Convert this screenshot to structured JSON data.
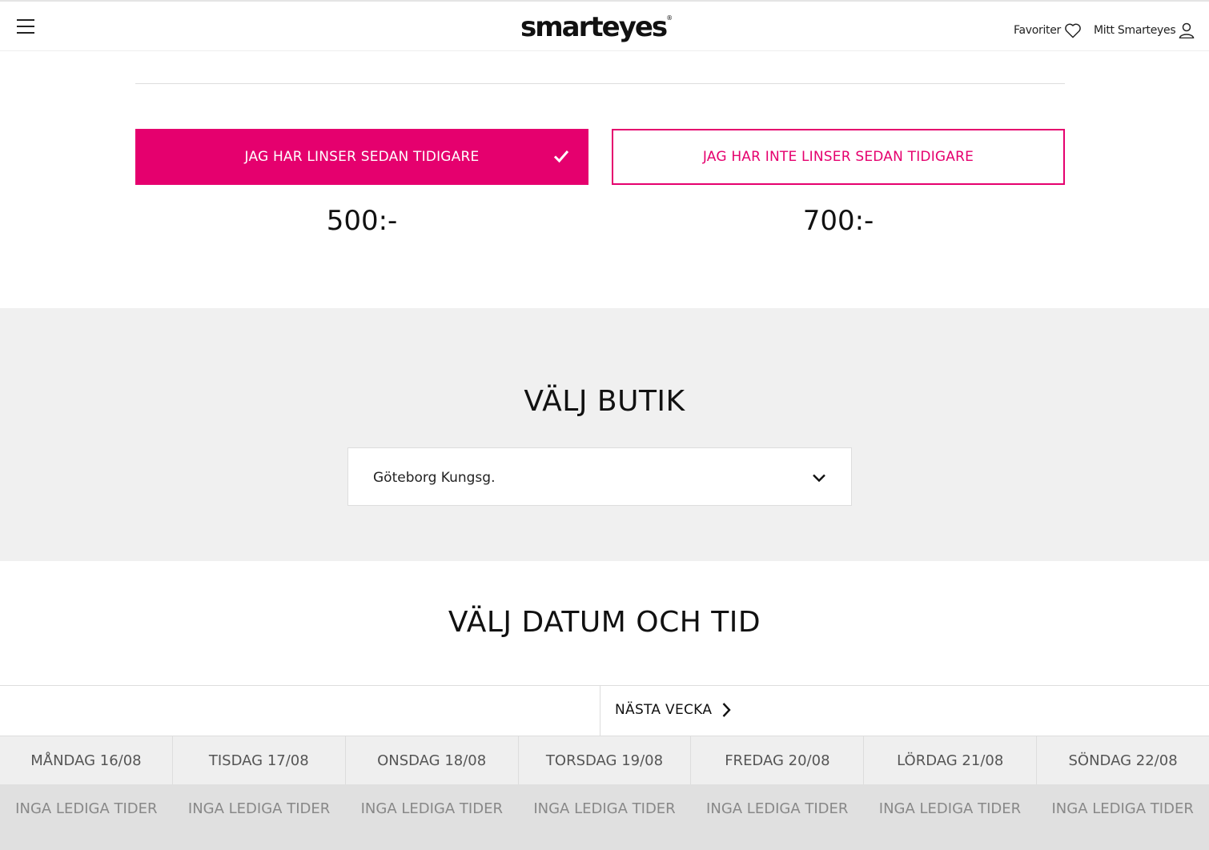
{
  "header": {
    "logo_text": "smarteyes",
    "logo_mark": "®",
    "favorites_label": "Favoriter",
    "account_label": "Mitt Smarteyes",
    "menu_icon": "hamburger-icon",
    "favorites_icon": "heart-icon",
    "account_icon": "user-icon"
  },
  "lens_options": {
    "option_a_label": "JAG HAR LINSER SEDAN TIDIGARE",
    "option_a_price": "500:-",
    "option_b_label": "JAG HAR INTE LINSER SEDAN TIDIGARE",
    "option_b_price": "700:-",
    "selected": "option_a",
    "accent_color": "#e5006e"
  },
  "store": {
    "title": "VÄLJ BUTIK",
    "selected_store": "Göteborg Kungsg."
  },
  "schedule": {
    "title": "VÄLJ DATUM OCH TID",
    "next_week_label": "NÄSTA VECKA",
    "days": [
      {
        "label": "MÅNDAG 16/08",
        "status": "INGA LEDIGA TIDER"
      },
      {
        "label": "TISDAG 17/08",
        "status": "INGA LEDIGA TIDER"
      },
      {
        "label": "ONSDAG 18/08",
        "status": "INGA LEDIGA TIDER"
      },
      {
        "label": "TORSDAG 19/08",
        "status": "INGA LEDIGA TIDER"
      },
      {
        "label": "FREDAG 20/08",
        "status": "INGA LEDIGA TIDER"
      },
      {
        "label": "LÖRDAG 21/08",
        "status": "INGA LEDIGA TIDER"
      },
      {
        "label": "SÖNDAG 22/08",
        "status": "INGA LEDIGA TIDER"
      }
    ]
  }
}
